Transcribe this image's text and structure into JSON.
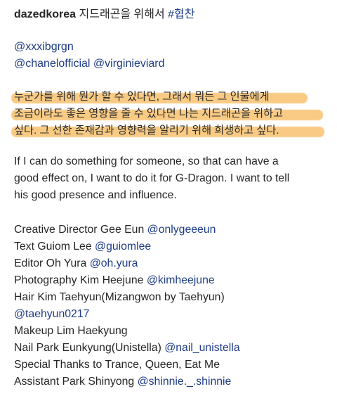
{
  "header": {
    "username": "dazedkorea",
    "caption": "지드래곤을 위해서",
    "hashtag": "#협찬"
  },
  "mentions": [
    "@xxxibgrgn",
    "@chanelofficial",
    "@virginieviard"
  ],
  "korean_text": [
    "누군가를 위해 뭔가 할 수 있다면, 그래서 뭐든 그 인물에게",
    "조금이라도 좋은 영향을 줄 수 있다면 나는 지드래곤을 위하고",
    "싶다. 그 선한 존재감과 영향력을 알리기 위해 희생하고 싶다."
  ],
  "highlight_color": "#f4aa37",
  "english_text": [
    "If I can do something for someone, so that can have a",
    "good effect on, I want to do it for G-Dragon. I want to tell",
    "his good presence and influence."
  ],
  "credits": [
    {
      "text": "Creative Director Gee Eun",
      "handle": "@onlygeeeun"
    },
    {
      "text": "Text Guiom Lee",
      "handle": "@guiomlee"
    },
    {
      "text": "Editor Oh Yura",
      "handle": "@oh.yura"
    },
    {
      "text": "Photography Kim Heejune",
      "handle": "@kimheejune"
    },
    {
      "text": "Hair Kim Taehyun(Mizangwon by Taehyun)",
      "handle": ""
    },
    {
      "text": "",
      "handle": "@taehyun0217"
    },
    {
      "text": "Makeup Lim Haekyung",
      "handle": ""
    },
    {
      "text": "Nail Park Eunkyung(Unistella)",
      "handle": "@nail_unistella"
    },
    {
      "text": "Special Thanks to Trance, Queen, Eat Me",
      "handle": ""
    },
    {
      "text": "Assistant Park Shinyong",
      "handle": "@shinnie._.shinnie"
    }
  ],
  "link_color": "#1f3c88"
}
